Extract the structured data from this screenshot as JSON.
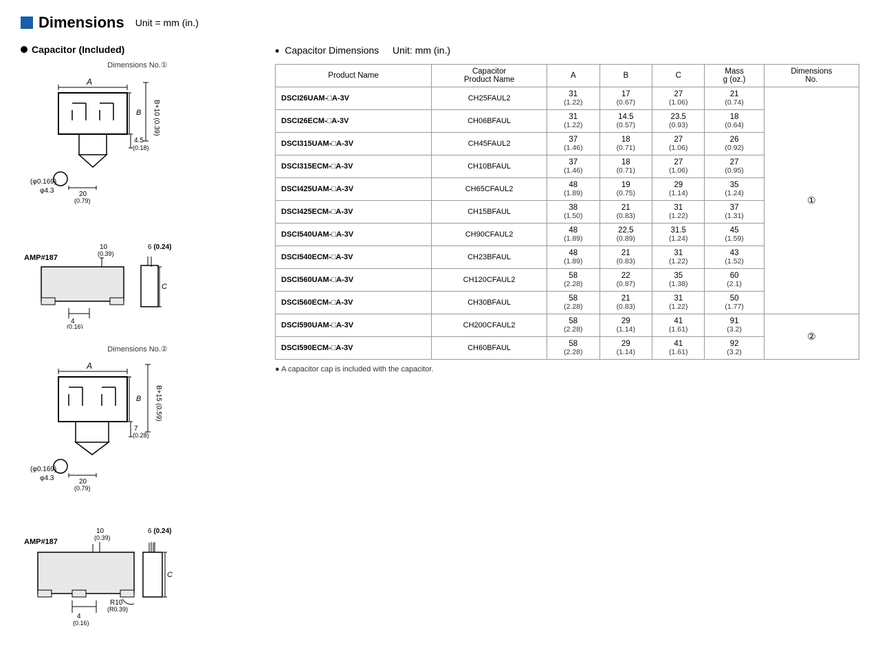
{
  "header": {
    "blue_box": true,
    "title": "Dimensions",
    "unit_label": "Unit = mm (in.)"
  },
  "left_section": {
    "title": "Capacitor (Included)",
    "diagram1_label": "Dimensions No.①",
    "diagram2_label": "Dimensions No.②"
  },
  "right_section": {
    "title": "Capacitor Dimensions",
    "unit_label": "Unit: mm (in.)",
    "table_headers": [
      "Product Name",
      "Capacitor\nProduct Name",
      "A",
      "B",
      "C",
      "Mass\ng (oz.)",
      "Dimensions\nNo."
    ],
    "rows": [
      {
        "product": "DSCI26UAM-□A-3V",
        "cap": "CH25FAUL2",
        "A": "31\n(1.22)",
        "B": "17\n(0.67)",
        "C": "27\n(1.06)",
        "mass": "21\n(0.74)",
        "dim_no": ""
      },
      {
        "product": "DSCI26ECM-□A-3V",
        "cap": "CH06BFAUL",
        "A": "31\n(1.22)",
        "B": "14.5\n(0.57)",
        "C": "23.5\n(0.93)",
        "mass": "18\n(0.64)",
        "dim_no": ""
      },
      {
        "product": "DSCI315UAM-□A-3V",
        "cap": "CH45FAUL2",
        "A": "37\n(1.46)",
        "B": "18\n(0.71)",
        "C": "27\n(1.06)",
        "mass": "26\n(0.92)",
        "dim_no": ""
      },
      {
        "product": "DSCI315ECM-□A-3V",
        "cap": "CH10BFAUL",
        "A": "37\n(1.46)",
        "B": "18\n(0.71)",
        "C": "27\n(1.06)",
        "mass": "27\n(0.95)",
        "dim_no": ""
      },
      {
        "product": "DSCI425UAM-□A-3V",
        "cap": "CH65CFAUL2",
        "A": "48\n(1.89)",
        "B": "19\n(0.75)",
        "C": "29\n(1.14)",
        "mass": "35\n(1.24)",
        "dim_no": "①"
      },
      {
        "product": "DSCI425ECM-□A-3V",
        "cap": "CH15BFAUL",
        "A": "38\n(1.50)",
        "B": "21\n(0.83)",
        "C": "31\n(1.22)",
        "mass": "37\n(1.31)",
        "dim_no": ""
      },
      {
        "product": "DSCI540UAM-□A-3V",
        "cap": "CH90CFAUL2",
        "A": "48\n(1.89)",
        "B": "22.5\n(0.89)",
        "C": "31.5\n(1.24)",
        "mass": "45\n(1.59)",
        "dim_no": ""
      },
      {
        "product": "DSCI540ECM-□A-3V",
        "cap": "CH23BFAUL",
        "A": "48\n(1.89)",
        "B": "21\n(0.83)",
        "C": "31\n(1.22)",
        "mass": "43\n(1.52)",
        "dim_no": ""
      },
      {
        "product": "DSCI560UAM-□A-3V",
        "cap": "CH120CFAUL2",
        "A": "58\n(2.28)",
        "B": "22\n(0.87)",
        "C": "35\n(1.38)",
        "mass": "60\n(2.1)",
        "dim_no": ""
      },
      {
        "product": "DSCI560ECM-□A-3V",
        "cap": "CH30BFAUL",
        "A": "58\n(2.28)",
        "B": "21\n(0.83)",
        "C": "31\n(1.22)",
        "mass": "50\n(1.77)",
        "dim_no": ""
      },
      {
        "product": "DSCI590UAM-□A-3V",
        "cap": "CH200CFAUL2",
        "A": "58\n(2.28)",
        "B": "29\n(1.14)",
        "C": "41\n(1.61)",
        "mass": "91\n(3.2)",
        "dim_no": "②"
      },
      {
        "product": "DSCI590ECM-□A-3V",
        "cap": "CH60BFAUL",
        "A": "58\n(2.28)",
        "B": "29\n(1.14)",
        "C": "41\n(1.61)",
        "mass": "92\n(3.2)",
        "dim_no": ""
      }
    ],
    "footnote": "● A capacitor cap is included with the capacitor."
  }
}
